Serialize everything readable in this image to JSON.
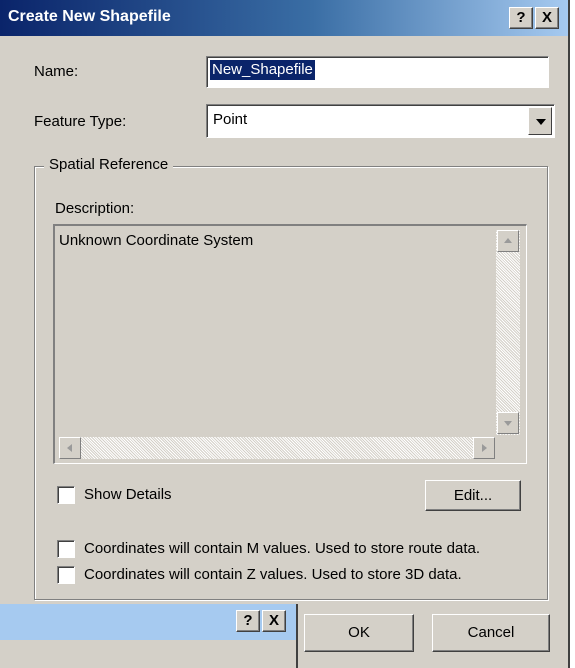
{
  "window": {
    "title": "Create New Shapefile",
    "help_button": "?",
    "close_button": "X"
  },
  "name_field": {
    "label": "Name:",
    "value": "New_Shapefile"
  },
  "feature_type": {
    "label": "Feature Type:",
    "selected": "Point"
  },
  "spatial_reference": {
    "group_title": "Spatial Reference",
    "description_label": "Description:",
    "description_text": "Unknown Coordinate System",
    "show_details_label": "Show Details",
    "show_details_checked": false,
    "edit_button": "Edit..."
  },
  "options": {
    "m_values_label": "Coordinates will contain M values. Used to store route data.",
    "m_values_checked": false,
    "z_values_label": "Coordinates will contain Z values. Used to store 3D data.",
    "z_values_checked": false
  },
  "footer": {
    "ok_button": "OK",
    "cancel_button": "Cancel"
  },
  "overlay_window": {
    "help_button": "?",
    "close_button": "X"
  },
  "colors": {
    "titlebar_start": "#0a246a",
    "titlebar_end": "#a6caf0",
    "dialog_face": "#d4d0c8",
    "selection": "#0a246a"
  }
}
